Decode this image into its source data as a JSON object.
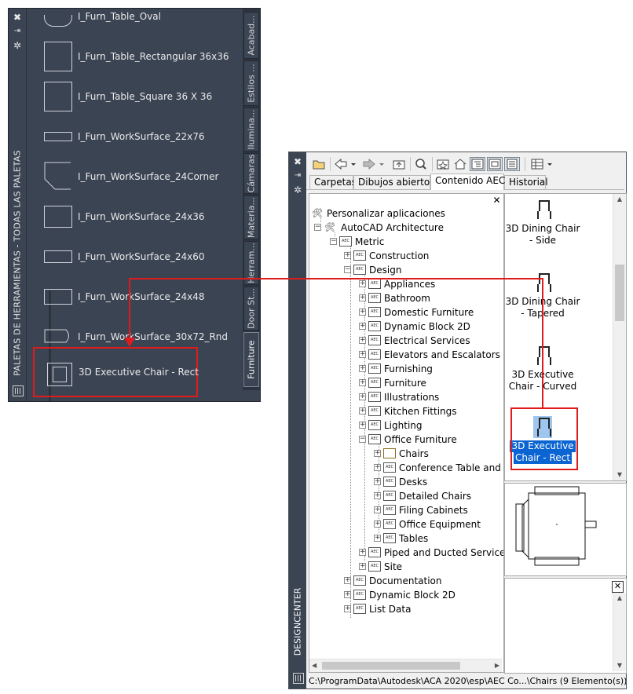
{
  "tool_palette": {
    "title": "PALETAS DE HERRAMIENTAS - TODAS LAS PALETAS",
    "items": [
      {
        "label": "I_Furn_Table_Oval"
      },
      {
        "label": "I_Furn_Table_Rectangular 36x36"
      },
      {
        "label": "I_Furn_Table_Square 36 X 36"
      },
      {
        "label": "I_Furn_WorkSurface_22x76"
      },
      {
        "label": "I_Furn_WorkSurface_24Corner"
      },
      {
        "label": "I_Furn_WorkSurface_24x36"
      },
      {
        "label": "I_Furn_WorkSurface_24x60"
      },
      {
        "label": "I_Furn_WorkSurface_24x48"
      },
      {
        "label": "I_Furn_WorkSurface_30x72_Rnd"
      }
    ],
    "selected_item": {
      "label": "3D Executive Chair - Rect"
    },
    "tabs": [
      "Acabad...",
      "Estilos ...",
      "Ilumina...",
      "Cámaras",
      "Materia...",
      "Herram...",
      "Door St...",
      "Furniture"
    ],
    "active_tab": "Furniture"
  },
  "designcenter": {
    "title": "DESIGNCENTER",
    "tabs": [
      "Carpetas",
      "Dibujos abiertos",
      "Contenido AEC",
      "Historial"
    ],
    "active_tab": "Contenido AEC",
    "tree": [
      {
        "label": "Personalizar aplicaciones"
      },
      {
        "label": "AutoCAD Architecture"
      },
      {
        "label": "Metric"
      },
      {
        "label": "Construction"
      },
      {
        "label": "Design"
      },
      {
        "label": "Appliances"
      },
      {
        "label": "Bathroom"
      },
      {
        "label": "Domestic Furniture"
      },
      {
        "label": "Dynamic Block 2D"
      },
      {
        "label": "Electrical Services"
      },
      {
        "label": "Elevators and Escalators"
      },
      {
        "label": "Furnishing"
      },
      {
        "label": "Furniture"
      },
      {
        "label": "Illustrations"
      },
      {
        "label": "Kitchen Fittings"
      },
      {
        "label": "Lighting"
      },
      {
        "label": "Office Furniture"
      },
      {
        "label": "Chairs"
      },
      {
        "label": "Conference Table and C"
      },
      {
        "label": "Desks"
      },
      {
        "label": "Detailed Chairs"
      },
      {
        "label": "Filing Cabinets"
      },
      {
        "label": "Office Equipment"
      },
      {
        "label": "Tables"
      },
      {
        "label": "Piped and Ducted Services"
      },
      {
        "label": "Site"
      },
      {
        "label": "Documentation"
      },
      {
        "label": "Dynamic Block 2D"
      },
      {
        "label": "List Data"
      }
    ],
    "palette_items": [
      {
        "line1": "3D Dining Chair",
        "line2": "- Side"
      },
      {
        "line1": "3D Dining Chair",
        "line2": "- Tapered"
      },
      {
        "line1": "3D Executive",
        "line2": "Chair - Curved"
      },
      {
        "line1": "3D Executive",
        "line2": "Chair - Rect"
      }
    ],
    "status_path": "C:\\ProgramData\\Autodesk\\ACA 2020\\esp\\AEC Co...\\Chairs (9 Elemento(s))"
  },
  "colors": {
    "palette_bg": "#3b4453",
    "highlight": "#e01b1b",
    "selection": "#0a64d2"
  }
}
